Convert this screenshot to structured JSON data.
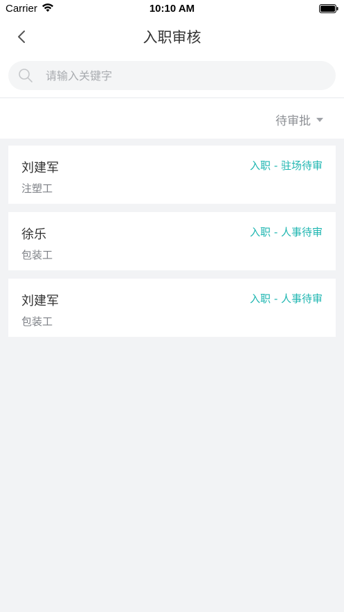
{
  "status_bar": {
    "carrier": "Carrier",
    "time": "10:10 AM"
  },
  "nav": {
    "title": "入职审核",
    "back_icon": "chevron-left-icon"
  },
  "search": {
    "placeholder": "请输入关键字",
    "value": ""
  },
  "filter": {
    "selected": "待审批"
  },
  "records": [
    {
      "name": "刘建军",
      "job": "注塑工",
      "status": "入职 - 驻场待审"
    },
    {
      "name": "徐乐",
      "job": "包装工",
      "status": "入职 - 人事待审"
    },
    {
      "name": "刘建军",
      "job": "包装工",
      "status": "入职 - 人事待审"
    }
  ],
  "colors": {
    "accent": "#1fb6b1",
    "background": "#f2f3f5"
  }
}
